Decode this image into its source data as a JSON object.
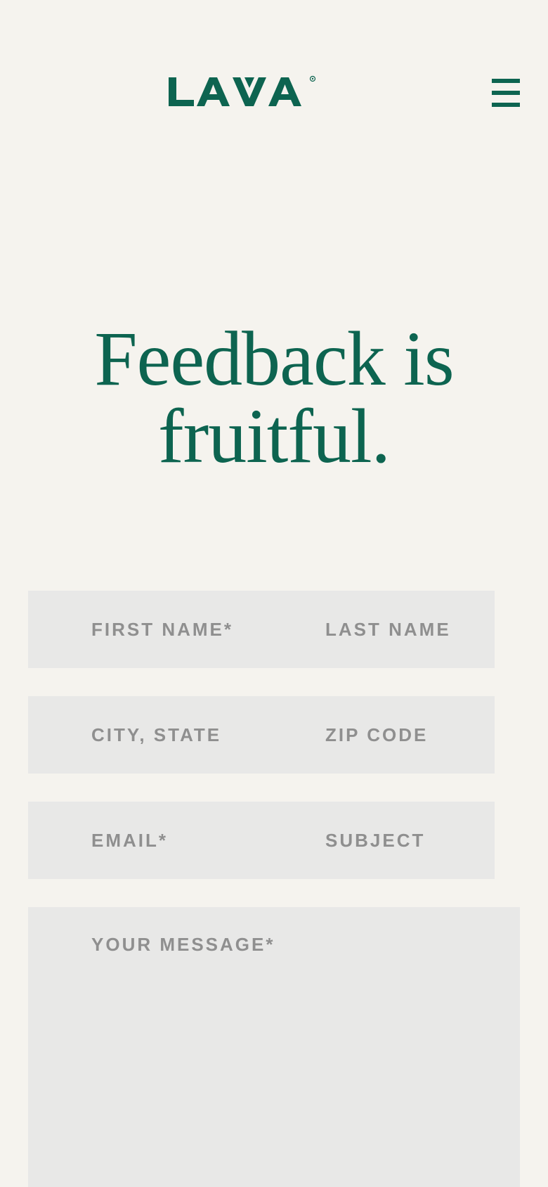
{
  "header": {
    "logo_text": "LAVA",
    "menu_icon": "hamburger-menu-icon"
  },
  "hero": {
    "headline_line1": "Feedback is",
    "headline_line2": "fruitful."
  },
  "form": {
    "first_name_placeholder": "FIRST NAME*",
    "last_name_placeholder": "LAST NAME",
    "city_state_placeholder": "CITY, STATE",
    "zip_code_placeholder": "ZIP CODE",
    "email_placeholder": "EMAIL*",
    "subject_placeholder": "SUBJECT",
    "message_placeholder": "YOUR MESSAGE*"
  },
  "colors": {
    "brand_green": "#0d6450",
    "background": "#f5f3ee",
    "field_background": "#e8e8e7",
    "placeholder_gray": "#8f8f8f"
  }
}
